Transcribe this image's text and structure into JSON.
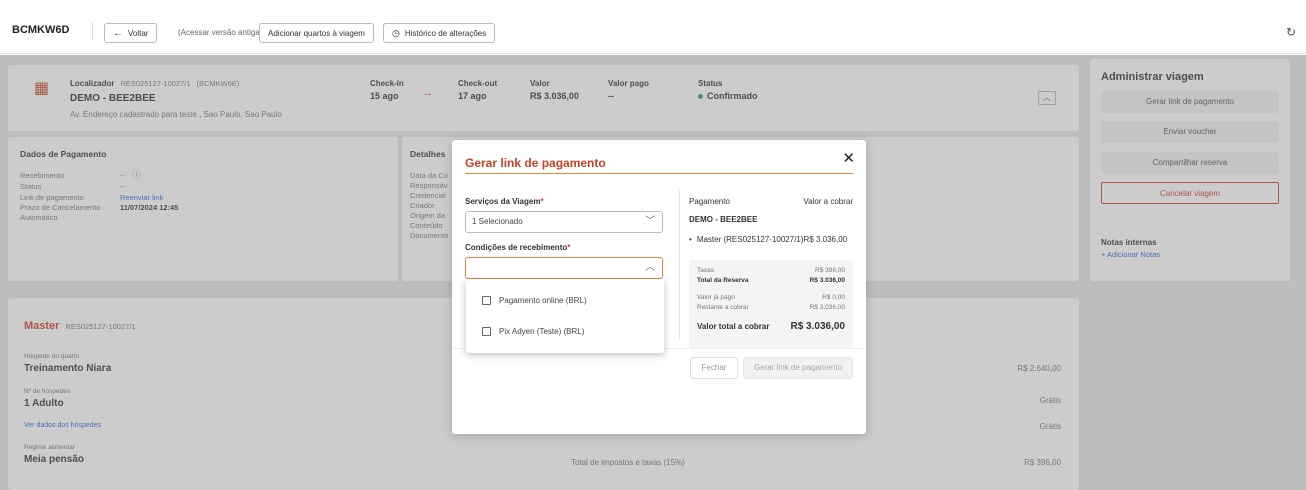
{
  "topbar": {
    "booking_code": "BCMKW6D",
    "back_label": "Voltar",
    "old_version_label": "(Acessar versão antiga)",
    "add_rooms_label": "Adicionar quartos à viagem",
    "history_label": "Histórico de alterações"
  },
  "booking": {
    "locator_label": "Localizador",
    "locator_value": "RES025127-10027/1",
    "locator_code": "(BCMKW6E)",
    "hotel_name": "DEMO - BEE2BEE",
    "address": "Av. Endereço cadastrado para teste , Sao Paulo, Sao Paulo",
    "checkin_label": "Check-in",
    "checkin_value": "15 ago",
    "checkout_label": "Check-out",
    "checkout_value": "17 ago",
    "value_label": "Valor",
    "value_value": "R$ 3.036,00",
    "paid_label": "Valor pago",
    "paid_value": "--",
    "status_label": "Status",
    "status_value": "Confirmado"
  },
  "payment_data": {
    "title": "Dados de Pagamento",
    "receipt_label": "Recebimento",
    "receipt_value": "--",
    "status_label": "Status",
    "status_value": "--",
    "payment_link_label": "Link de pagamento",
    "payment_link_action": "Reenviar link",
    "cancel_deadline_label": "Prazo de Cancelamento",
    "cancel_deadline_value": "11/07/2024 12:45",
    "automatic_label": "Automático"
  },
  "details": {
    "title": "Detalhes",
    "rows": [
      "Data da Co",
      "Responsáv",
      "Credencial",
      "Criador",
      "Origem da",
      "Conteúdo",
      "Documento"
    ]
  },
  "room": {
    "title": "Master",
    "locator": "RES025127-10027/1",
    "guest_label": "Hóspede do quarto",
    "guest_value": "Treinamento Niara",
    "guests_count_label": "Nº de hóspedes",
    "guests_count_value": "1 Adulto",
    "view_guests_link": "Ver dados dos hóspedes",
    "meal_label": "Regime alimentar",
    "meal_value": "Meia pensão"
  },
  "pricing": {
    "row1_value": "R$ 2.640,00",
    "row2_value": "Grátis",
    "row3_value": "Grátis",
    "taxes_label": "Total de impostos e taxas (15%)",
    "taxes_value": "R$ 396,00"
  },
  "sidebar": {
    "title": "Administrar viagem",
    "buttons": [
      "Gerar link de pagamento",
      "Enviar voucher",
      "Compartilhar reserva"
    ],
    "cancel_label": "Cancelar viagem",
    "notes_title": "Notas internas",
    "add_notes_link": "+ Adicionar Notas"
  },
  "modal": {
    "title": "Gerar link de pagamento",
    "services_label": "Serviços da Viagem",
    "services_value": "1 Selecionado",
    "conditions_label": "Condições de recebimento",
    "conditions_value": "",
    "payment_col_label": "Pagamento",
    "amount_col_label": "Valor a cobrar",
    "hotel_name": "DEMO - BEE2BEE",
    "item_label": "Master (RES025127-10027/1)R$ 3.036,00",
    "taxes_label": "Taxas",
    "taxes_value": "R$ 396,00",
    "total_label": "Total da Reserva",
    "total_value": "R$ 3.036,00",
    "paid_label": "Valor já pago",
    "paid_value": "R$ 0,00",
    "remaining_label": "Restante a cobrar",
    "remaining_value": "R$ 3.036,00",
    "grand_label": "Valor total a cobrar",
    "grand_value": "R$ 3.036,00",
    "close_label": "Fechar",
    "generate_label": "Gerar link de pagamento"
  },
  "dropdown": {
    "options": [
      "Pagamento online (BRL)",
      "Pix Adyen (Teste) (BRL)"
    ]
  },
  "colors": {
    "accent": "#c94026",
    "status_green": "#2e9d4e",
    "link_blue": "#2a6fd6"
  }
}
